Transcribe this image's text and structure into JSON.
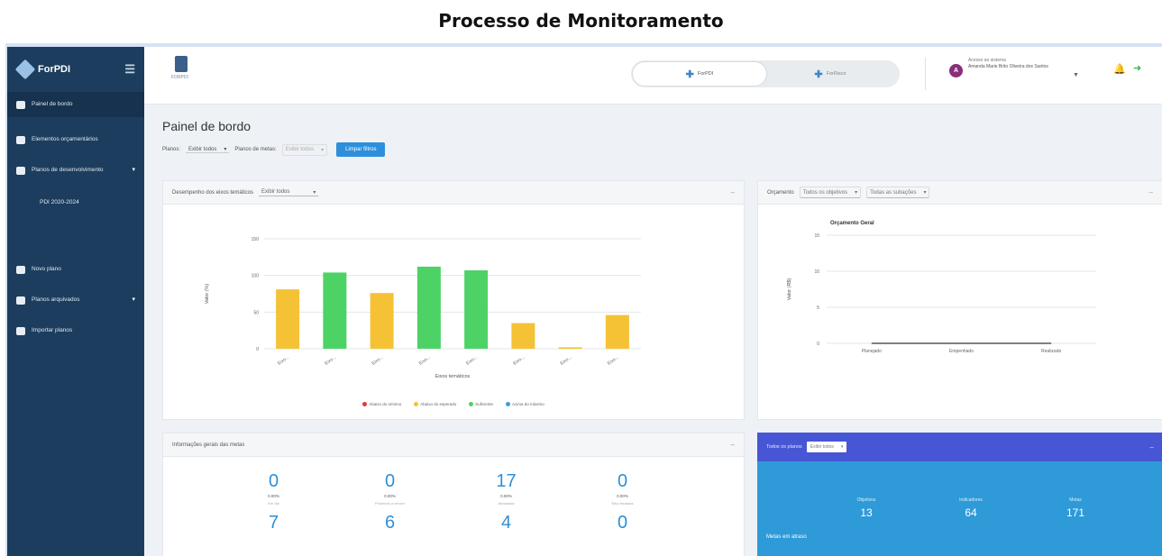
{
  "page_heading": "Processo de Monitoramento",
  "sidebar": {
    "brand": "ForPDI",
    "items": [
      {
        "label": "Painel de bordo",
        "icon": "dashboard-icon",
        "active": true
      },
      {
        "label": "Elementos orçamentários",
        "icon": "wallet-icon"
      },
      {
        "label": "Planos de desenvolvimento",
        "icon": "list-icon",
        "chevron": true
      },
      {
        "label": "PDI 2020-2024",
        "sub": true
      },
      {
        "label": "Novo plano",
        "icon": "plus-circle-icon"
      },
      {
        "label": "Planos arquivados",
        "icon": "archive-icon",
        "chevron": true
      },
      {
        "label": "Importar planos",
        "icon": "import-icon"
      }
    ]
  },
  "topbar": {
    "logo_sub": "FORPDI",
    "toggle_left": "ForPDI",
    "toggle_right": "ForRisco",
    "user_greeting": "Acesso ao sistema",
    "user_name": "Amanda Marie Brito Oliveira dos Santos",
    "avatar_initial": "A"
  },
  "main": {
    "title": "Painel de bordo",
    "filter_plans_label": "Planos:",
    "filter_plans_value": "Exibir todos",
    "filter_goals_label": "Planos de metas:",
    "filter_goals_value": "Exibir todos",
    "clear_button": "Limpar filtros"
  },
  "performance_panel": {
    "title": "Desempenho dos eixos temáticos",
    "select_value": "Exibir todos"
  },
  "budget_panel": {
    "title": "Orçamento",
    "select1": "Todos os objetivos",
    "select2": "Todas as subações"
  },
  "general_info_panel": {
    "title": "Informações gerais das metas",
    "stats": [
      {
        "num": "0",
        "pct": "0.00%",
        "label": "Em dia"
      },
      {
        "num": "0",
        "pct": "0.00%",
        "label": "Próximas a vencer"
      },
      {
        "num": "17",
        "pct": "0.00%",
        "label": "Atrasadas"
      },
      {
        "num": "0",
        "pct": "0.00%",
        "label": "Não iniciadas"
      }
    ],
    "stats_row2": [
      "7",
      "6",
      "4",
      "0"
    ]
  },
  "summary_panel": {
    "label": "Todos os planos",
    "select_value": "Exibir todos",
    "goals": [
      {
        "label": "Objetivos",
        "value": "13"
      },
      {
        "label": "Indicadores",
        "value": "64"
      },
      {
        "label": "Metas",
        "value": "171"
      }
    ],
    "footer": "Metas em atraso"
  },
  "chart_data": [
    {
      "type": "bar",
      "categories": [
        "Eixo...",
        "Eixo...",
        "Eixo...",
        "Eixo...",
        "Eixo...",
        "Eixo...",
        "Eixo...",
        "Eixo..."
      ],
      "values": [
        81,
        104,
        76,
        112,
        107,
        35,
        2,
        46
      ],
      "colors": [
        "#f5c236",
        "#4dd365",
        "#f5c236",
        "#4dd365",
        "#4dd365",
        "#f5c236",
        "#f5c236",
        "#f5c236"
      ],
      "ylim": [
        0,
        150
      ],
      "yticks": [
        "0",
        "50",
        "100",
        "150"
      ],
      "xlabel": "Eixos temáticos",
      "ylabel": "Valor (%)",
      "legend": [
        {
          "name": "Abaixo do mínimo",
          "color": "#e03a3a"
        },
        {
          "name": "Abaixo do esperado",
          "color": "#f5c236"
        },
        {
          "name": "Suficiente",
          "color": "#4dd365"
        },
        {
          "name": "Acima do máximo",
          "color": "#3b9fe0"
        }
      ]
    },
    {
      "type": "line",
      "title": "Orçamento Geral",
      "categories": [
        "Planejado",
        "Empenhado",
        "Realizado"
      ],
      "values": [
        0,
        0,
        0
      ],
      "ylim": [
        0,
        15
      ],
      "yticks": [
        "0",
        "5",
        "10",
        "15"
      ],
      "ylabel": "Valor (R$)"
    }
  ]
}
